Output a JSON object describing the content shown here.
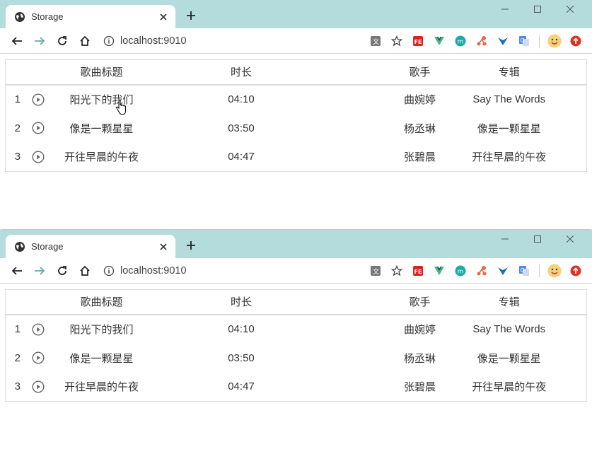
{
  "browser": {
    "tab_title": "Storage",
    "url": "localhost:9010"
  },
  "table": {
    "headers": [
      "歌曲标题",
      "时长",
      "歌手",
      "专辑"
    ],
    "rows": [
      {
        "num": "1",
        "title": "阳光下的我们",
        "duration": "04:10",
        "artist": "曲婉婷",
        "album": "Say The Words"
      },
      {
        "num": "2",
        "title": "像是一颗星星",
        "duration": "03:50",
        "artist": "杨丞琳",
        "album": "像是一颗星星"
      },
      {
        "num": "3",
        "title": "开往早晨的午夜",
        "duration": "04:47",
        "artist": "张碧晨",
        "album": "开往早晨的午夜"
      }
    ]
  },
  "colors": {
    "tabbar": "#b4dcdd",
    "icon": "#555555"
  }
}
